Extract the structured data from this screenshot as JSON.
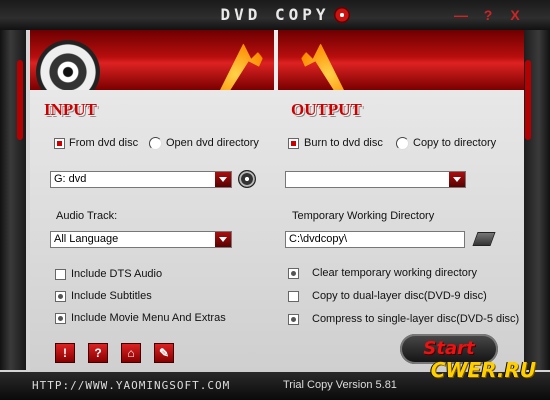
{
  "window": {
    "title": "DVD COPY",
    "minimize": "—",
    "help": "?",
    "close": "X"
  },
  "input": {
    "heading": "INPUT",
    "source_dvd_label": "From dvd disc",
    "source_dir_label": "Open dvd directory",
    "drive_value": "G: dvd",
    "audio_track_label": "Audio Track:",
    "audio_track_value": "All Language",
    "options": [
      {
        "label": "Include DTS Audio",
        "checked": false
      },
      {
        "label": "Include Subtitles",
        "checked": true
      },
      {
        "label": "Include Movie Menu And Extras",
        "checked": true
      }
    ],
    "toolbar": [
      "!",
      "?",
      "⌂",
      "✎"
    ]
  },
  "output": {
    "heading": "OUTPUT",
    "burn_label": "Burn to dvd disc",
    "copy_dir_label": "Copy to directory",
    "target_value": "",
    "temp_dir_label": "Temporary Working Directory",
    "temp_dir_value": "C:\\dvdcopy\\",
    "options": [
      {
        "label": "Clear temporary working directory",
        "checked": true
      },
      {
        "label": "Copy to dual-layer disc(DVD-9 disc)",
        "checked": false
      },
      {
        "label": "Compress to single-layer disc(DVD-5 disc)",
        "checked": true
      }
    ],
    "start_label": "Start"
  },
  "footer": {
    "url": "HTTP://WWW.YAOMINGSOFT.COM",
    "version": "Trial Copy Version 5.81",
    "watermark": "CWER.RU"
  }
}
